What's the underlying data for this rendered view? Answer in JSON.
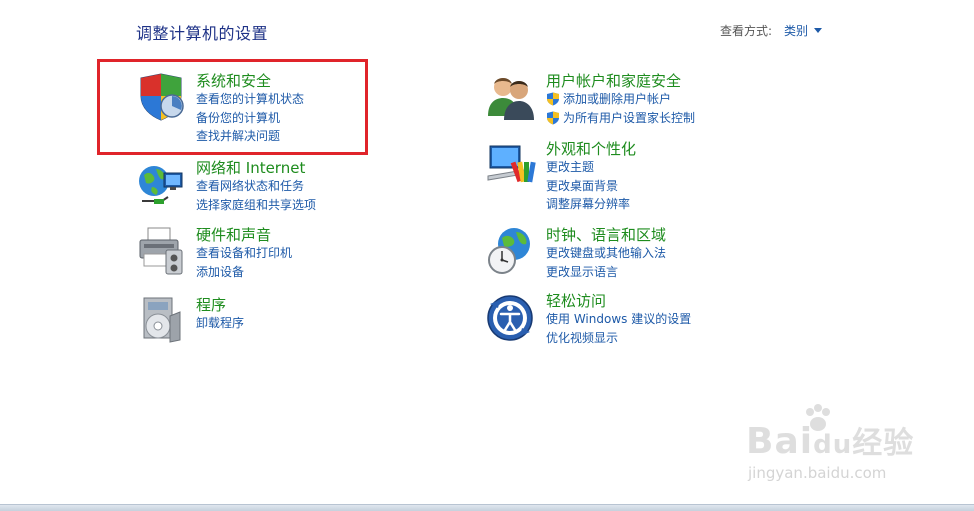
{
  "header": {
    "title": "调整计算机的设置",
    "view_by_label": "查看方式:",
    "view_by_value": "类别"
  },
  "categories": {
    "system_security": {
      "title": "系统和安全",
      "links": [
        "查看您的计算机状态",
        "备份您的计算机",
        "查找并解决问题"
      ]
    },
    "network": {
      "title": "网络和 Internet",
      "links": [
        "查看网络状态和任务",
        "选择家庭组和共享选项"
      ]
    },
    "hardware": {
      "title": "硬件和声音",
      "links": [
        "查看设备和打印机",
        "添加设备"
      ]
    },
    "programs": {
      "title": "程序",
      "links": [
        "卸载程序"
      ]
    },
    "user_accounts": {
      "title": "用户帐户和家庭安全",
      "links": [
        "添加或删除用户帐户",
        "为所有用户设置家长控制"
      ]
    },
    "appearance": {
      "title": "外观和个性化",
      "links": [
        "更改主题",
        "更改桌面背景",
        "调整屏幕分辨率"
      ]
    },
    "clock": {
      "title": "时钟、语言和区域",
      "links": [
        "更改键盘或其他输入法",
        "更改显示语言"
      ]
    },
    "ease": {
      "title": "轻松访问",
      "links": [
        "使用 Windows 建议的设置",
        "优化视频显示"
      ]
    }
  },
  "watermark": {
    "brand": "Bai",
    "brand_cn": "经验",
    "url": "jingyan.baidu.com"
  },
  "colors": {
    "title_blue": "#1e3287",
    "category_green": "#1e8c1e",
    "link_blue": "#1e5aa8",
    "highlight_red": "#e0242a"
  }
}
